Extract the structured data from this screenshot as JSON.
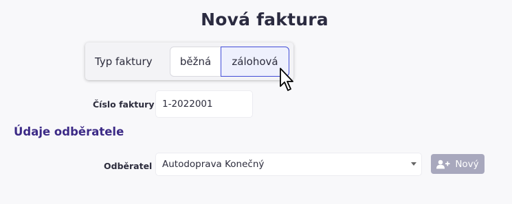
{
  "page": {
    "title": "Nová faktura"
  },
  "invoice_type": {
    "label": "Typ faktury",
    "options": [
      "běžná",
      "zálohová"
    ],
    "selected": "zálohová"
  },
  "invoice_number": {
    "label": "Číslo faktury",
    "value": "1-2022001"
  },
  "customer_section": {
    "title": "Údaje odběratele"
  },
  "customer": {
    "label": "Odběratel",
    "selected": "Autodoprava Konečný",
    "new_button_label": "Nový",
    "new_button_icon": "user-plus-icon"
  },
  "colors": {
    "accent": "#3f4bd7",
    "section_title": "#3c2a86",
    "disabled_button": "#a8a8bd"
  }
}
